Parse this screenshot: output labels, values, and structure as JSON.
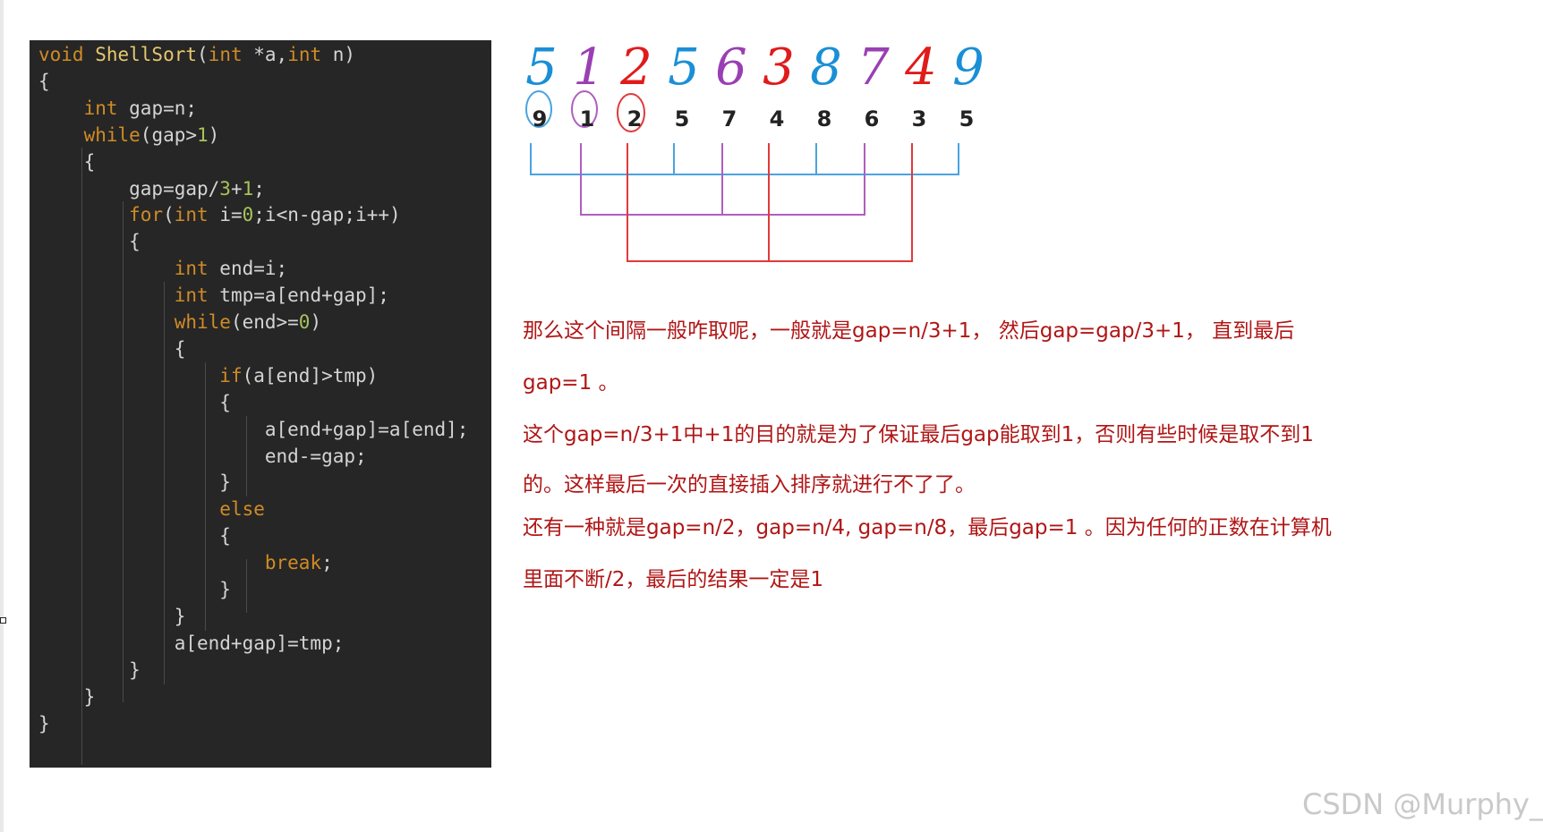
{
  "code": {
    "lines": [
      [
        {
          "t": "void ",
          "c": "kw"
        },
        {
          "t": "ShellSort",
          "c": "fn"
        },
        {
          "t": "(",
          "c": "pun"
        },
        {
          "t": "int",
          "c": "kw"
        },
        {
          "t": " *a,",
          "c": "plain"
        },
        {
          "t": "int",
          "c": "kw"
        },
        {
          "t": " n)",
          "c": "plain"
        }
      ],
      [
        {
          "t": "{",
          "c": "pun"
        }
      ],
      [
        {
          "t": "    ",
          "c": "plain"
        },
        {
          "t": "int",
          "c": "kw"
        },
        {
          "t": " gap=n;",
          "c": "plain"
        }
      ],
      [
        {
          "t": "    ",
          "c": "plain"
        },
        {
          "t": "while",
          "c": "kw"
        },
        {
          "t": "(gap>",
          "c": "plain"
        },
        {
          "t": "1",
          "c": "num"
        },
        {
          "t": ")",
          "c": "plain"
        }
      ],
      [
        {
          "t": "    {",
          "c": "pun"
        }
      ],
      [
        {
          "t": "        gap=gap/",
          "c": "plain"
        },
        {
          "t": "3",
          "c": "num"
        },
        {
          "t": "+",
          "c": "plain"
        },
        {
          "t": "1",
          "c": "num"
        },
        {
          "t": ";",
          "c": "plain"
        }
      ],
      [
        {
          "t": "        ",
          "c": "plain"
        },
        {
          "t": "for",
          "c": "kw"
        },
        {
          "t": "(",
          "c": "plain"
        },
        {
          "t": "int",
          "c": "kw"
        },
        {
          "t": " i=",
          "c": "plain"
        },
        {
          "t": "0",
          "c": "num"
        },
        {
          "t": ";i<n-gap;i++)",
          "c": "plain"
        }
      ],
      [
        {
          "t": "        {",
          "c": "pun"
        }
      ],
      [
        {
          "t": "            ",
          "c": "plain"
        },
        {
          "t": "int",
          "c": "kw"
        },
        {
          "t": " end=i;",
          "c": "plain"
        }
      ],
      [
        {
          "t": "            ",
          "c": "plain"
        },
        {
          "t": "int",
          "c": "kw"
        },
        {
          "t": " tmp=a[end+gap];",
          "c": "plain"
        }
      ],
      [
        {
          "t": "            ",
          "c": "plain"
        },
        {
          "t": "while",
          "c": "kw"
        },
        {
          "t": "(end>=",
          "c": "plain"
        },
        {
          "t": "0",
          "c": "num"
        },
        {
          "t": ")",
          "c": "plain"
        }
      ],
      [
        {
          "t": "            {",
          "c": "pun"
        }
      ],
      [
        {
          "t": "                ",
          "c": "plain"
        },
        {
          "t": "if",
          "c": "kw"
        },
        {
          "t": "(a[end]>tmp)",
          "c": "plain"
        }
      ],
      [
        {
          "t": "                {",
          "c": "pun"
        }
      ],
      [
        {
          "t": "                    a[end+gap]=a[end];",
          "c": "plain"
        }
      ],
      [
        {
          "t": "                    end-=gap;",
          "c": "plain"
        }
      ],
      [
        {
          "t": "                }",
          "c": "pun"
        }
      ],
      [
        {
          "t": "                ",
          "c": "plain"
        },
        {
          "t": "else",
          "c": "kw"
        }
      ],
      [
        {
          "t": "                {",
          "c": "pun"
        }
      ],
      [
        {
          "t": "                    ",
          "c": "plain"
        },
        {
          "t": "break",
          "c": "kw"
        },
        {
          "t": ";",
          "c": "plain"
        }
      ],
      [
        {
          "t": "                }",
          "c": "pun"
        }
      ],
      [
        {
          "t": "            }",
          "c": "pun"
        }
      ],
      [
        {
          "t": "            a[end+gap]=tmp;",
          "c": "plain"
        }
      ],
      [
        {
          "t": "        }",
          "c": "pun"
        }
      ],
      [
        {
          "t": "    }",
          "c": "pun"
        }
      ],
      [
        {
          "t": "}",
          "c": "pun"
        }
      ]
    ]
  },
  "diagram": {
    "handwritten": [
      {
        "ch": "5",
        "color": "#1a8fd6"
      },
      {
        "ch": "1",
        "color": "#9a3fb3"
      },
      {
        "ch": "2",
        "color": "#e01b1b"
      },
      {
        "ch": "5",
        "color": "#1a8fd6"
      },
      {
        "ch": "6",
        "color": "#9a3fb3"
      },
      {
        "ch": "3",
        "color": "#e01b1b"
      },
      {
        "ch": "8",
        "color": "#1a8fd6"
      },
      {
        "ch": "7",
        "color": "#9a3fb3"
      },
      {
        "ch": "4",
        "color": "#e01b1b"
      },
      {
        "ch": "9",
        "color": "#1a8fd6"
      }
    ],
    "numbers": [
      "9",
      "1",
      "2",
      "5",
      "7",
      "4",
      "8",
      "6",
      "3",
      "5"
    ],
    "group_colors": {
      "blue": "#4aa3e0",
      "purple": "#b05ec0",
      "red": "#e03a3a"
    }
  },
  "explanation": {
    "p1_l1": "那么这个间隔一般咋取呢，一般就是gap=n/3+1， 然后gap=gap/3+1， 直到最后",
    "p1_l2": "gap=1 。",
    "p2_l1": "这个gap=n/3+1中+1的目的就是为了保证最后gap能取到1，否则有些时候是取不到1",
    "p2_l2": "的。这样最后一次的直接插入排序就进行不了了。",
    "p3_l1": "还有一种就是gap=n/2，gap=n/4, gap=n/8，最后gap=1 。因为任何的正数在计算机",
    "p3_l2": "里面不断/2，最后的结果一定是1"
  },
  "watermark": "CSDN @Murphy_lx"
}
